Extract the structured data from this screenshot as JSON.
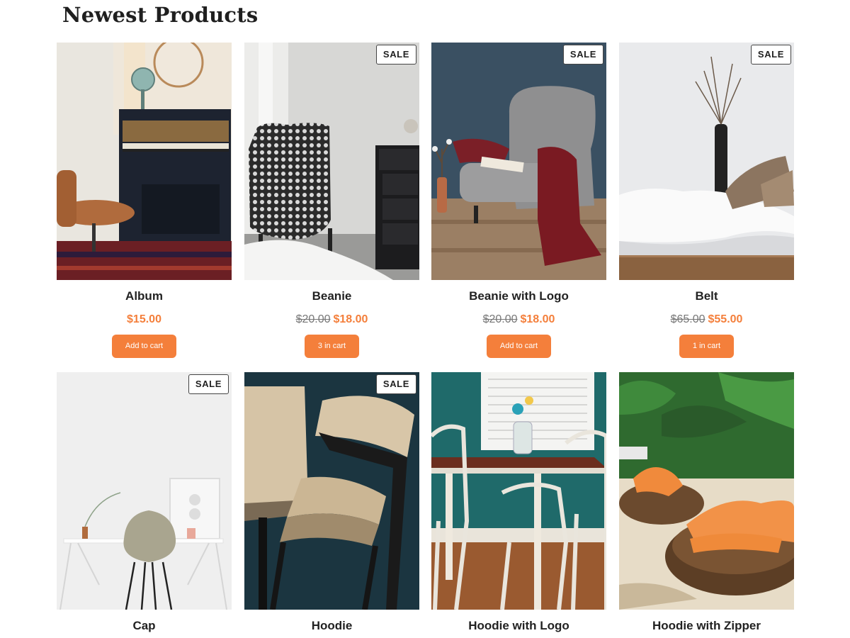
{
  "section": {
    "title": "Newest Products"
  },
  "products": [
    {
      "name": "Album",
      "sale_badge": "",
      "old_price": "",
      "price": "$15.00",
      "button": "Add to cart"
    },
    {
      "name": "Beanie",
      "sale_badge": "SALE",
      "old_price": "$20.00",
      "price": "$18.00",
      "button": "3 in cart"
    },
    {
      "name": "Beanie with Logo",
      "sale_badge": "SALE",
      "old_price": "$20.00",
      "price": "$18.00",
      "button": "Add to cart"
    },
    {
      "name": "Belt",
      "sale_badge": "SALE",
      "old_price": "$65.00",
      "price": "$55.00",
      "button": "1 in cart"
    },
    {
      "name": "Cap",
      "sale_badge": "SALE"
    },
    {
      "name": "Hoodie",
      "sale_badge": "SALE"
    },
    {
      "name": "Hoodie with Logo",
      "sale_badge": ""
    },
    {
      "name": "Hoodie with Zipper",
      "sale_badge": ""
    }
  ],
  "colors": {
    "accent": "#f47f3b",
    "text": "#222222"
  },
  "icons": {
    "album": "piano-room-photo",
    "beanie": "patterned-armchair-photo",
    "beanie_with_logo": "grey-wingback-chair-photo",
    "belt": "white-chaise-lounge-photo",
    "cap": "white-desk-chair-photo",
    "hoodie": "wooden-chairs-photo",
    "hoodie_with_logo": "dining-table-photo",
    "hoodie_with_zipper": "wicker-patio-chairs-photo"
  }
}
